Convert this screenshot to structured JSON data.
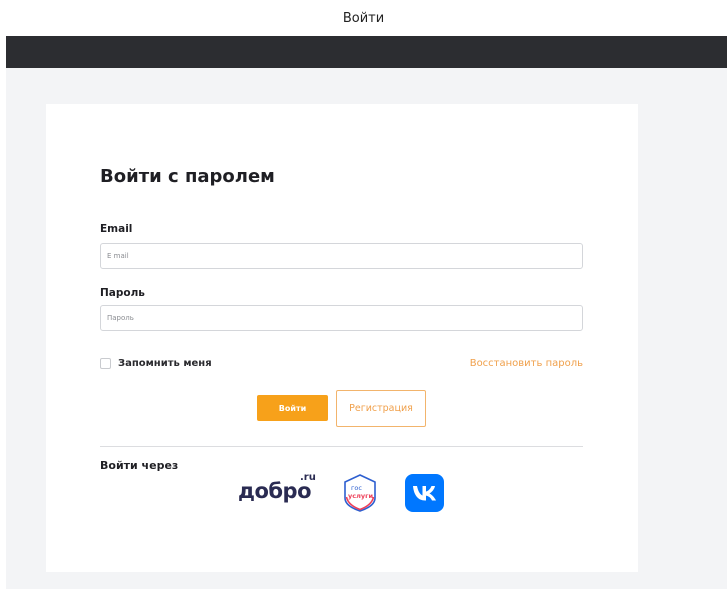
{
  "window": {
    "title": "Войти"
  },
  "form": {
    "heading": "Войти с паролем",
    "email_label": "Email",
    "email_placeholder": "E mail",
    "email_value": "",
    "password_label": "Пароль",
    "password_placeholder": "Пароль",
    "password_value": "",
    "remember_label": "Запомнить меня",
    "restore_link": "Восстановить пароль",
    "login_button": "Войти",
    "register_button": "Регистрация"
  },
  "social": {
    "heading": "Войти черeз",
    "providers": [
      {
        "name": "dobro",
        "logo_text": "добро",
        "logo_suffix": ".ru",
        "color": "#2a2b52"
      },
      {
        "name": "gosuslugi",
        "logo_line1": "гос",
        "logo_line2": "услуги",
        "color": "#ee3f58"
      },
      {
        "name": "vk",
        "color": "#0077ff"
      }
    ]
  },
  "colors": {
    "accent": "#f7a11a",
    "link": "#f0a04b",
    "topbar": "#2c2d31",
    "page_bg": "#f3f4f6"
  }
}
